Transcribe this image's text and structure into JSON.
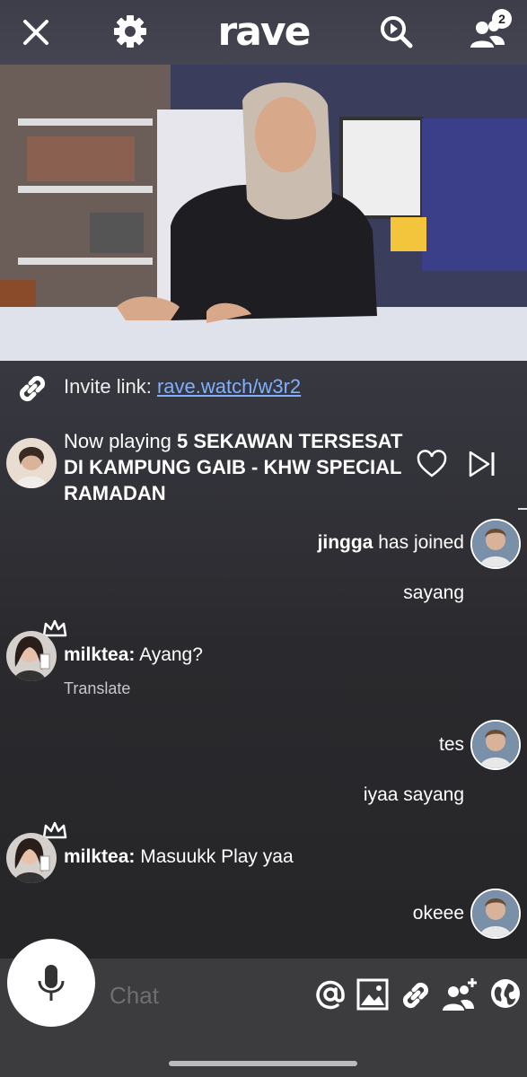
{
  "app": {
    "logo_text": "rave",
    "participants_count": "2"
  },
  "topbar": {
    "close_icon": "close-icon",
    "settings_icon": "gear-icon",
    "search_icon": "search-video-icon",
    "participants_icon": "people-icon"
  },
  "invite": {
    "label": "Invite link:",
    "link": "rave.watch/w3r2",
    "icon": "link-icon"
  },
  "now_playing": {
    "prefix": "Now playing",
    "title": "5 SEKAWAN TERSESAT DI KAMPUNG GAIB - KHW SPECIAL RAMADAN"
  },
  "chat": [
    {
      "side": "right",
      "user": "jingga",
      "text": "has joined"
    },
    {
      "side": "right",
      "user": "",
      "text": "sayang"
    },
    {
      "side": "left",
      "user": "milktea:",
      "text": "Ayang?",
      "translate": "Translate"
    },
    {
      "side": "right",
      "user": "",
      "text": "tes"
    },
    {
      "side": "right",
      "user": "",
      "text": "iyaa sayang"
    },
    {
      "side": "left",
      "user": "milktea:",
      "text": "Masuukk Play yaa"
    },
    {
      "side": "right",
      "user": "",
      "text": "okeee"
    }
  ],
  "composer": {
    "placeholder": "Chat"
  },
  "colors": {
    "link": "#7fb0ff",
    "background": "#2a2a2e"
  }
}
